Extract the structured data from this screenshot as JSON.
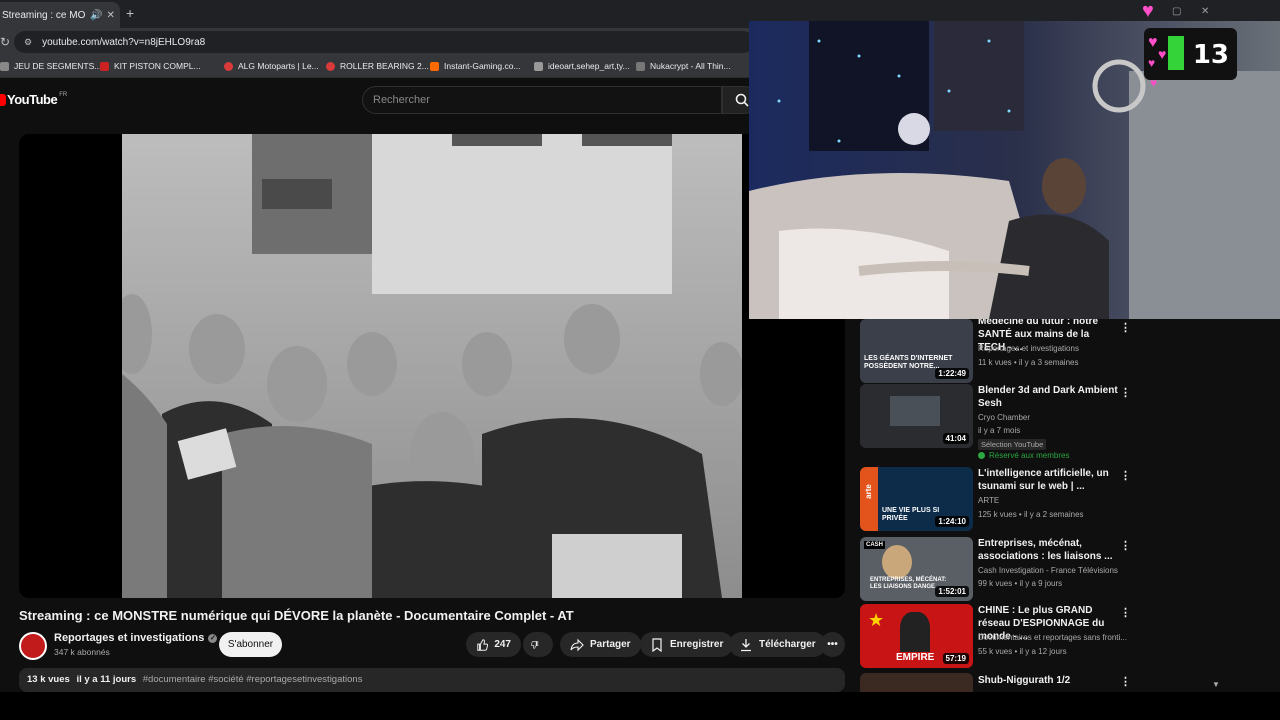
{
  "browser": {
    "tab_title": "Streaming : ce MONSTRE",
    "tab_audio_icon": "speaker-icon",
    "new_tab_label": "+",
    "url": "youtube.com/watch?v=n8jEHLO9ra8",
    "bookmarks": [
      {
        "label": "JEU DE SEGMENTS...",
        "color": "#888888"
      },
      {
        "label": "KIT PISTON COMPL...",
        "color": "#cc2222"
      },
      {
        "label": "ALG Motoparts | Le...",
        "color": "#d93a3a"
      },
      {
        "label": "ROLLER BEARING 2...",
        "color": "#d93a3a"
      },
      {
        "label": "Instant-Gaming.co...",
        "color": "#ff6a00"
      },
      {
        "label": "ideoart,sehep_art,ty...",
        "color": "#999999"
      },
      {
        "label": "Nukacrypt - All Thin...",
        "color": "#777777"
      }
    ]
  },
  "youtube": {
    "logo_text": "YouTube",
    "country_code": "FR",
    "search_placeholder": "Rechercher"
  },
  "video": {
    "title": "Streaming : ce MONSTRE numérique qui DÉVORE la planète - Documentaire Complet - AT",
    "channel_name": "Reportages et investigations",
    "subscribers": "347 k abonnés",
    "subscribe_label": "S'abonner",
    "like_count": "247",
    "share_label": "Partager",
    "save_label": "Enregistrer",
    "download_label": "Télécharger",
    "views": "13 k vues",
    "date": "il y a 11 jours",
    "tags": "#documentaire #société #reportagesetinvestigations"
  },
  "recommendations": [
    {
      "title": "Médecine du futur : notre SANTÉ aux mains de la TECH - ...",
      "channel": "Reportages et investigations",
      "meta": "11 k vues • il y a 3 semaines",
      "duration": "1:22:49",
      "thumb_text": "LES GÉANTS D'INTERNET POSSÈDENT NOTRE...",
      "thumb_color": "#3a3f4a"
    },
    {
      "title": "Blender 3d and Dark Ambient Sesh",
      "channel": "Cryo Chamber",
      "meta": "il y a 7 mois",
      "badge": "Sélection YouTube",
      "member": "Réservé aux membres",
      "duration": "41:04",
      "thumb_color": "#2a2c30"
    },
    {
      "title": "L'intelligence artificielle, un tsunami sur le web | ...",
      "channel": "ARTE",
      "meta": "125 k vues • il y a 2 semaines",
      "duration": "1:24:10",
      "thumb_text": "UNE VIE PLUS SI PRIVÉE",
      "thumb_brand": "arte",
      "thumb_color": "#0d2c4a"
    },
    {
      "title": "Entreprises, mécénat, associations : les liaisons ...",
      "channel": "Cash Investigation - France Télévisions",
      "meta": "99 k vues • il y a 9 jours",
      "duration": "1:52:01",
      "thumb_text": "ENTREPRISES, MÉCÉNAT: LES LIAISONS DANGE...",
      "thumb_brand": "CASH",
      "thumb_color": "#5a5f66"
    },
    {
      "title": "CHINE : Le plus GRAND réseau D'ESPIONNAGE du monde - ...",
      "channel": "Documentaires et reportages sans fronti...",
      "meta": "55 k vues • il y a 12 jours",
      "duration": "57:19",
      "thumb_text": "EMPIRE",
      "thumb_color": "#c81414"
    },
    {
      "title": "Shub-Niggurath 1/2",
      "channel": "",
      "meta": "",
      "duration": "",
      "thumb_color": "#3a2a22"
    }
  ],
  "overlay": {
    "counter_value": "13"
  }
}
